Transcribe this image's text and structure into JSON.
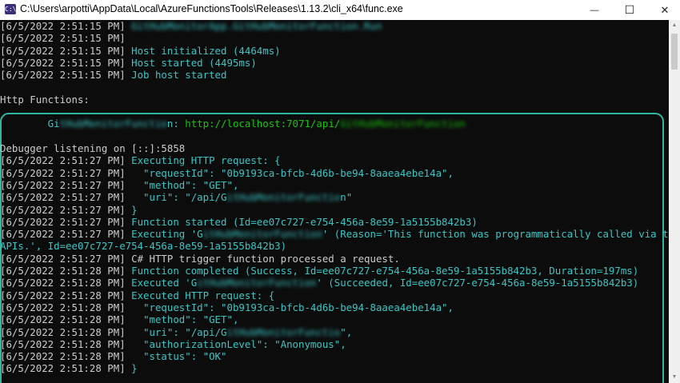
{
  "window": {
    "title": "C:\\Users\\arpotti\\AppData\\Local\\AzureFunctionsTools\\Releases\\1.13.2\\cli_x64\\func.exe",
    "icon": "console-app-icon",
    "icon_text": "C:\\",
    "min_symbol": "—",
    "max_symbol": "☐",
    "close_symbol": "✕"
  },
  "console": {
    "highlight_color": "#2fb5a1",
    "colors": {
      "background": "#0c0c0c",
      "text": "#cccccc",
      "info": "#3ac6c6",
      "url": "#16c60c"
    },
    "lines": [
      [
        {
          "t": "[6/5/2022 2:51:15 PM] "
        },
        {
          "t": "GitHubMonitorApp.GitHubMonitorFunction.Run",
          "c": "cyan",
          "blur": true
        }
      ],
      [
        {
          "t": "[6/5/2022 2:51:15 PM] "
        }
      ],
      [
        {
          "t": "[6/5/2022 2:51:15 PM] "
        },
        {
          "t": "Host initialized (4464ms)",
          "c": "cyan"
        }
      ],
      [
        {
          "t": "[6/5/2022 2:51:15 PM] "
        },
        {
          "t": "Host started (4495ms)",
          "c": "cyan"
        }
      ],
      [
        {
          "t": "[6/5/2022 2:51:15 PM] "
        },
        {
          "t": "Job host started",
          "c": "cyan"
        }
      ],
      [],
      [
        {
          "t": "Http Functions:"
        }
      ],
      [],
      [
        {
          "t": "        Gi",
          "c": "cyan"
        },
        {
          "t": "tHubMonitorFunctio",
          "c": "cyan",
          "blur": true
        },
        {
          "t": "n: ",
          "c": "cyan"
        },
        {
          "t": "http://localhost:7071/api/",
          "c": "green"
        },
        {
          "t": "GitHubMonitorFunction",
          "c": "green",
          "blur": true
        }
      ],
      [],
      [
        {
          "t": "Debugger listening on [::]:5858"
        }
      ],
      [
        {
          "t": "[6/5/2022 2:51:27 PM] "
        },
        {
          "t": "Executing HTTP request: {",
          "c": "cyan"
        }
      ],
      [
        {
          "t": "[6/5/2022 2:51:27 PM] "
        },
        {
          "t": "  \"requestId\": \"0b9193ca-bfcb-4d6b-be94-8aaea4ebe14a\",",
          "c": "cyan"
        }
      ],
      [
        {
          "t": "[6/5/2022 2:51:27 PM] "
        },
        {
          "t": "  \"method\": \"GET\",",
          "c": "cyan"
        }
      ],
      [
        {
          "t": "[6/5/2022 2:51:27 PM] "
        },
        {
          "t": "  \"uri\": \"/api/G",
          "c": "cyan"
        },
        {
          "t": "itHubMonitorFunctio",
          "c": "cyan",
          "blur": true
        },
        {
          "t": "n\"",
          "c": "cyan"
        }
      ],
      [
        {
          "t": "[6/5/2022 2:51:27 PM] "
        },
        {
          "t": "}",
          "c": "cyan"
        }
      ],
      [
        {
          "t": "[6/5/2022 2:51:27 PM] "
        },
        {
          "t": "Function started (Id=ee07c727-e754-456a-8e59-1a5155b842b3)",
          "c": "cyan"
        }
      ],
      [
        {
          "t": "[6/5/2022 2:51:27 PM] "
        },
        {
          "t": "Executing 'G",
          "c": "cyan"
        },
        {
          "t": "itHubMonitorFunction",
          "c": "cyan",
          "blur": true
        },
        {
          "t": "' (Reason='This function was programmatically called via the host",
          "c": "cyan"
        }
      ],
      [
        {
          "t": "APIs.', Id=ee07c727-e754-456a-8e59-1a5155b842b3)",
          "c": "cyan"
        }
      ],
      [
        {
          "t": "[6/5/2022 2:51:27 PM] "
        },
        {
          "t": "C# HTTP trigger function processed a request."
        }
      ],
      [
        {
          "t": "[6/5/2022 2:51:28 PM] "
        },
        {
          "t": "Function completed (Success, Id=ee07c727-e754-456a-8e59-1a5155b842b3, Duration=197ms)",
          "c": "cyan"
        }
      ],
      [
        {
          "t": "[6/5/2022 2:51:28 PM] "
        },
        {
          "t": "Executed 'G",
          "c": "cyan"
        },
        {
          "t": "itHubMonitorFunction",
          "c": "cyan",
          "blur": true
        },
        {
          "t": "' (Succeeded, Id=ee07c727-e754-456a-8e59-1a5155b842b3)",
          "c": "cyan"
        }
      ],
      [
        {
          "t": "[6/5/2022 2:51:28 PM] "
        },
        {
          "t": "Executed HTTP request: {",
          "c": "cyan"
        }
      ],
      [
        {
          "t": "[6/5/2022 2:51:28 PM] "
        },
        {
          "t": "  \"requestId\": \"0b9193ca-bfcb-4d6b-be94-8aaea4ebe14a\",",
          "c": "cyan"
        }
      ],
      [
        {
          "t": "[6/5/2022 2:51:28 PM] "
        },
        {
          "t": "  \"method\": \"GET\",",
          "c": "cyan"
        }
      ],
      [
        {
          "t": "[6/5/2022 2:51:28 PM] "
        },
        {
          "t": "  \"uri\": \"/api/G",
          "c": "cyan"
        },
        {
          "t": "itHubMonitorFunctio",
          "c": "cyan",
          "blur": true
        },
        {
          "t": "\",",
          "c": "cyan"
        }
      ],
      [
        {
          "t": "[6/5/2022 2:51:28 PM] "
        },
        {
          "t": "  \"authorizationLevel\": \"Anonymous\",",
          "c": "cyan"
        }
      ],
      [
        {
          "t": "[6/5/2022 2:51:28 PM] "
        },
        {
          "t": "  \"status\": \"OK\"",
          "c": "cyan"
        }
      ],
      [
        {
          "t": "[6/5/2022 2:51:28 PM] "
        },
        {
          "t": "}",
          "c": "cyan"
        }
      ]
    ]
  }
}
